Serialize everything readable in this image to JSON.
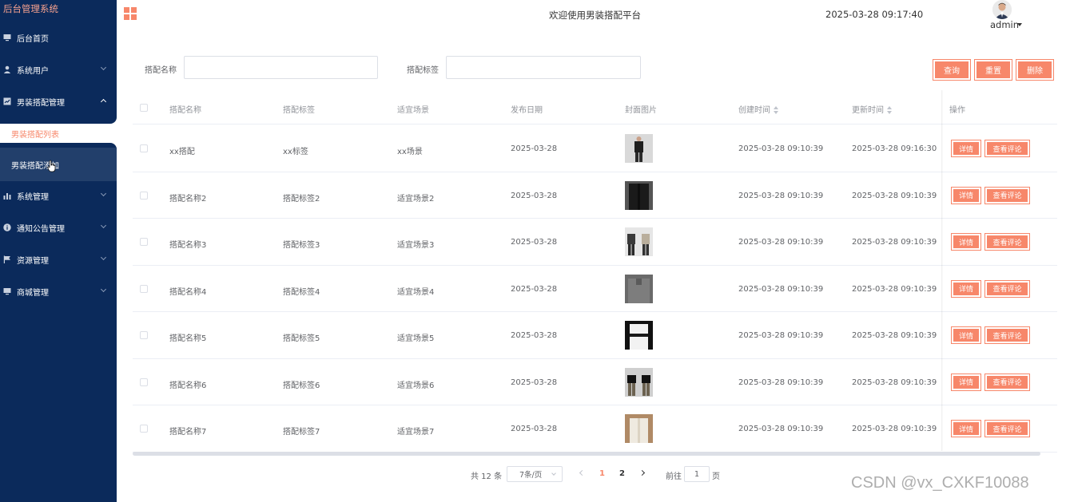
{
  "sidebar": {
    "title": "后台管理系统",
    "items": [
      {
        "label": "后台首页",
        "icon": "monitor-icon"
      },
      {
        "label": "系统用户",
        "icon": "user-icon"
      },
      {
        "label": "男装搭配管理",
        "icon": "chart-icon"
      },
      {
        "label": "系统管理",
        "icon": "bar-chart-icon"
      },
      {
        "label": "通知公告管理",
        "icon": "info-icon"
      },
      {
        "label": "资源管理",
        "icon": "flag-icon"
      },
      {
        "label": "商城管理",
        "icon": "monitor-icon"
      }
    ],
    "sub_items": [
      {
        "label": "男装搭配列表",
        "state": "active"
      },
      {
        "label": "男装搭配添加",
        "state": "hover"
      }
    ]
  },
  "header": {
    "welcome": "欢迎使用男装搭配平台",
    "datetime": "2025-03-28 09:17:40",
    "user": "admin"
  },
  "search": {
    "name_label": "搭配名称",
    "name_value": "",
    "tag_label": "搭配标签",
    "tag_value": "",
    "buttons": {
      "query": "查询",
      "reset": "重置",
      "delete": "删除"
    }
  },
  "table": {
    "columns": [
      "搭配名称",
      "搭配标签",
      "适宜场景",
      "发布日期",
      "封面图片",
      "创建时间",
      "更新时间",
      "操作"
    ],
    "rows": [
      {
        "name": "xx搭配",
        "tag": "xx标签",
        "scene": "xx场景",
        "date": "2025-03-28",
        "created": "2025-03-28 09:10:39",
        "updated": "2025-03-28 09:16:30"
      },
      {
        "name": "搭配名称2",
        "tag": "搭配标签2",
        "scene": "适宜场景2",
        "date": "2025-03-28",
        "created": "2025-03-28 09:10:39",
        "updated": "2025-03-28 09:10:39"
      },
      {
        "name": "搭配名称3",
        "tag": "搭配标签3",
        "scene": "适宜场景3",
        "date": "2025-03-28",
        "created": "2025-03-28 09:10:39",
        "updated": "2025-03-28 09:10:39"
      },
      {
        "name": "搭配名称4",
        "tag": "搭配标签4",
        "scene": "适宜场景4",
        "date": "2025-03-28",
        "created": "2025-03-28 09:10:39",
        "updated": "2025-03-28 09:10:39"
      },
      {
        "name": "搭配名称5",
        "tag": "搭配标签5",
        "scene": "适宜场景5",
        "date": "2025-03-28",
        "created": "2025-03-28 09:10:39",
        "updated": "2025-03-28 09:10:39"
      },
      {
        "name": "搭配名称6",
        "tag": "搭配标签6",
        "scene": "适宜场景6",
        "date": "2025-03-28",
        "created": "2025-03-28 09:10:39",
        "updated": "2025-03-28 09:10:39"
      },
      {
        "name": "搭配名称7",
        "tag": "搭配标签7",
        "scene": "适宜场景7",
        "date": "2025-03-28",
        "created": "2025-03-28 09:10:39",
        "updated": "2025-03-28 09:10:39"
      }
    ],
    "row_actions": {
      "detail": "详情",
      "comments": "查看评论"
    }
  },
  "pagination": {
    "total": "共 12 条",
    "page_size": "7条/页",
    "pages": [
      "1",
      "2"
    ],
    "current": "1",
    "goto_prefix": "前往",
    "goto_value": "1",
    "goto_suffix": "页"
  },
  "watermark": "CSDN @vx_CXKF10088",
  "colors": {
    "accent": "#f7876a",
    "sidebar": "#0b2a5b",
    "title": "#f7a28f"
  }
}
